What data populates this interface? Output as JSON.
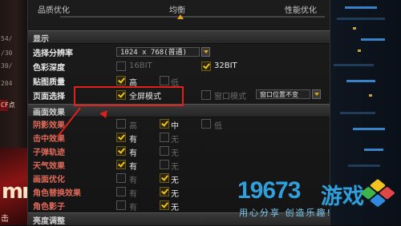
{
  "slider": {
    "left_label": "品质优化",
    "center_label": "均衡",
    "right_label": "性能优化"
  },
  "display_section": {
    "title": "显示",
    "resolution": {
      "label": "选择分辨率",
      "value": "1024 x 768(普通)"
    },
    "color_depth": {
      "label": "色彩深度",
      "options": [
        "16BIT",
        "32BIT"
      ],
      "selected": "32BIT"
    },
    "texture_quality": {
      "label": "贴图质量",
      "options": [
        "高",
        "低"
      ],
      "selected": "高"
    },
    "page_option": {
      "label": "页面选择",
      "options": [
        "全屏模式",
        "窗口模式"
      ],
      "selected": "全屏模式",
      "window_position": "窗口位置不变"
    }
  },
  "effects_section": {
    "title": "画面效果",
    "rows": [
      {
        "label": "阴影效果",
        "options": [
          "高",
          "中",
          "低"
        ],
        "selected": "中"
      },
      {
        "label": "击中效果",
        "options": [
          "有",
          "无"
        ],
        "selected": "有"
      },
      {
        "label": "子弹轨迹",
        "options": [
          "有",
          "无"
        ],
        "selected": "有"
      },
      {
        "label": "天气效果",
        "options": [
          "有",
          "无"
        ],
        "selected": "有"
      },
      {
        "label": "画面优化",
        "options": [
          "有",
          "无"
        ],
        "selected": "无"
      },
      {
        "label": "角色替换效果",
        "options": [
          "有",
          "无"
        ],
        "selected": "无"
      },
      {
        "label": "角色影子",
        "options": [
          "有",
          "无"
        ],
        "selected": "无"
      }
    ]
  },
  "next_section": {
    "title": "亮度调整"
  },
  "left_edge_text": [
    "54/",
    "/30",
    "30/",
    "204",
    "CF点",
    "mn",
    "击"
  ],
  "watermark": {
    "brand_number": "19673",
    "brand_name": "游戏",
    "slogan": "用心分享  创造乐趣!"
  },
  "colors": {
    "accent": "#f2c21e",
    "highlight": "#e0201c",
    "watermark": "#2fa0dc"
  }
}
